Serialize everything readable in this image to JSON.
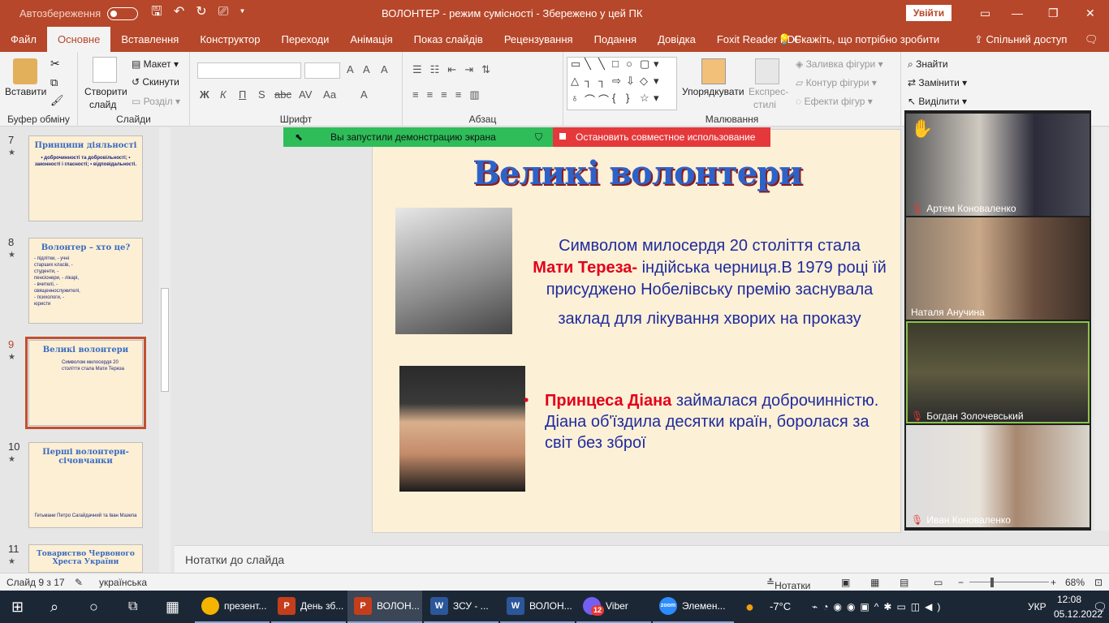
{
  "titlebar": {
    "autosave": "Автозбереження",
    "title": "ВОЛОНТЕР  -  режим сумісності  -  Збережено у цей ПК",
    "signin": "Увійти"
  },
  "tabs": [
    "Файл",
    "Основне",
    "Вставлення",
    "Конструктор",
    "Переходи",
    "Анімація",
    "Показ слайдів",
    "Рецензування",
    "Подання",
    "Довідка",
    "Foxit Reader PDF"
  ],
  "tell_me": "Скажіть, що потрібно зробити",
  "share": "Спільний доступ",
  "ribbon": {
    "clipboard": {
      "label": "Буфер обміну",
      "paste": "Вставити"
    },
    "slides": {
      "label": "Слайди",
      "new_slide": "Створити",
      "new_slide2": "слайд",
      "layout": "Макет",
      "reset": "Скинути",
      "section": "Розділ"
    },
    "font": {
      "label": "Шрифт",
      "bold": "Ж",
      "italic": "К",
      "underline": "П",
      "strike": "S",
      "aa": "Аа"
    },
    "paragraph": {
      "label": "Абзац"
    },
    "drawing": {
      "label": "Малювання",
      "arrange": "Упорядкувати",
      "quick1": "Експрес-",
      "quick2": "стилі",
      "fill": "Заливка фігури",
      "outline": "Контур фігури",
      "effects": "Ефекти фігур"
    },
    "editing": {
      "find": "Знайти",
      "replace": "Замінити",
      "select": "Виділити"
    }
  },
  "thumbs": [
    {
      "num": "7",
      "title": "Принципи діяльності",
      "text": "• доброчинності та добровільності; • законності і гласності; • відповідальності."
    },
    {
      "num": "8",
      "title": "Волонтер – хто це?",
      "text": "- підлітки, - учні старших класів, - студенти, - пенсіонери, - лікарі, - вчителі, - священнослужителі, - психологи, - юристи"
    },
    {
      "num": "9",
      "title": "Великі волонтери",
      "text": "Символом милосердя 20 століття стала Мати Тереза"
    },
    {
      "num": "10",
      "title": "Перші волонтери-січовчанки",
      "text": "Гетьмани Петро Сагайдачний та Іван Мазепа"
    },
    {
      "num": "11",
      "title": "Товариство Червоного Хреста України",
      "text": ""
    }
  ],
  "slide": {
    "title": "Великі волонтери",
    "p1_a": "Символом милосердя 20 століття стала",
    "p1_red": "Мати Тереза-",
    "p1_b": " індійська черниця.В 1979 році їй присуджено Нобелівську премію заснувала",
    "p1_c": "заклад для лікування хворих на проказу",
    "p2_red": "Принцеса Діана",
    "p2_b": " займалася доброчинністю. Діана об'їздила десятки країн, боролася за світ без зброї"
  },
  "share_bar": {
    "running": "Вы запустили демонстрацию экрана",
    "stop": "Остановить совместное использование"
  },
  "participants": [
    {
      "name": "Артем Коноваленко"
    },
    {
      "name": "Наталя Анучина"
    },
    {
      "name": "Богдан Золочевський"
    },
    {
      "name": "Иван Коноваленко"
    }
  ],
  "notes": "Нотатки до слайда",
  "status": {
    "slide": "Слайд 9 з 17",
    "lang": "українська",
    "notes": "Нотатки",
    "zoom": "68%"
  },
  "taskbar": {
    "apps": [
      {
        "label": "презент...",
        "icon": "chrome-icon",
        "color": "#f4b400"
      },
      {
        "label": "День зб...",
        "icon": "powerpoint-icon",
        "color": "#c43e1c"
      },
      {
        "label": "ВОЛОН...",
        "icon": "powerpoint-icon",
        "color": "#c43e1c"
      },
      {
        "label": "ЗСУ - ...",
        "icon": "word-icon",
        "color": "#2b579a"
      },
      {
        "label": "ВОЛОН...",
        "icon": "word-icon",
        "color": "#2b579a"
      },
      {
        "label": "Viber",
        "icon": "viber-icon",
        "color": "#7360f2"
      },
      {
        "label": "Элемен...",
        "icon": "zoom-icon",
        "color": "#2d8cff"
      }
    ],
    "weather": "-7°C",
    "lang": "УКР",
    "time": "12:08",
    "date": "05.12.2022",
    "viber_badge": "12"
  }
}
